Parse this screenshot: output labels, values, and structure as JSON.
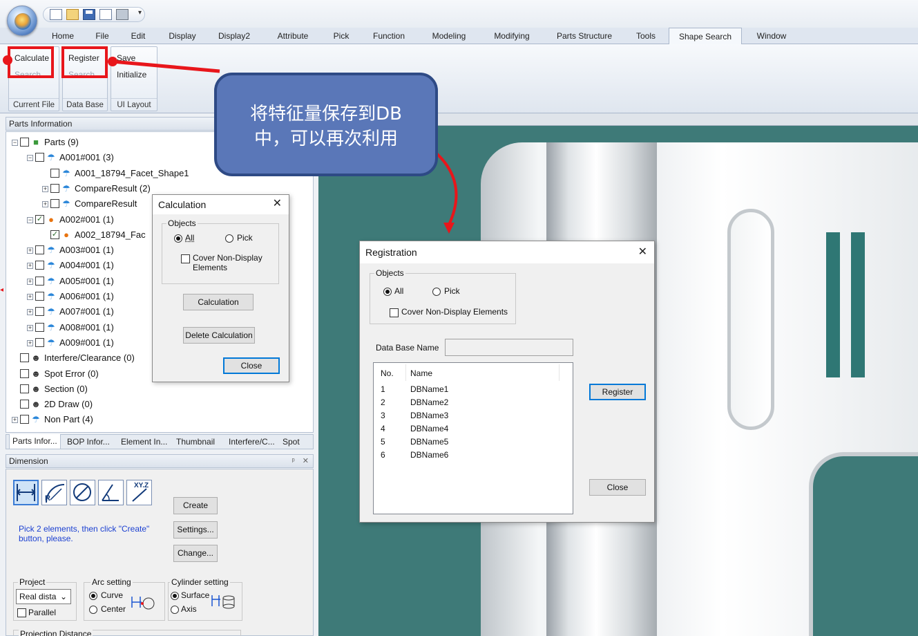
{
  "quick_access": {
    "more_label": "▾"
  },
  "ribbon": {
    "tabs": [
      "Home",
      "File",
      "Edit",
      "Display",
      "Display2",
      "Attribute",
      "Pick",
      "Function",
      "Modeling",
      "Modifying",
      "Parts Structure",
      "Tools",
      "Shape Search",
      "Window"
    ],
    "active_tab": "Shape Search",
    "groups": {
      "current_file": {
        "label": "Current File",
        "buttons": [
          "Calculate",
          "Search"
        ]
      },
      "data_base": {
        "label": "Data Base",
        "buttons": [
          "Register",
          "Search"
        ]
      },
      "ui_layout": {
        "label": "UI Layout",
        "buttons": [
          "Save",
          "Initialize"
        ]
      }
    }
  },
  "parts_panel": {
    "title": "Parts Information",
    "nodes": [
      {
        "label": "Parts (9)",
        "checked": false
      },
      {
        "label": "A001#001 (3)",
        "checked": false
      },
      {
        "label": "A001_18794_Facet_Shape1",
        "checked": false
      },
      {
        "label": "CompareResult (2)",
        "checked": false
      },
      {
        "label": "CompareResult",
        "checked": false
      },
      {
        "label": "A002#001 (1)",
        "checked": true
      },
      {
        "label": "A002_18794_Fac",
        "checked": true
      },
      {
        "label": "A003#001 (1)",
        "checked": false
      },
      {
        "label": "A004#001 (1)",
        "checked": false
      },
      {
        "label": "A005#001 (1)",
        "checked": false
      },
      {
        "label": "A006#001 (1)",
        "checked": false
      },
      {
        "label": "A007#001 (1)",
        "checked": false
      },
      {
        "label": "A008#001 (1)",
        "checked": false
      },
      {
        "label": "A009#001 (1)",
        "checked": false
      },
      {
        "label": "Interfere/Clearance (0)",
        "checked": false
      },
      {
        "label": "Spot Error (0)",
        "checked": false
      },
      {
        "label": "Section (0)",
        "checked": false
      },
      {
        "label": "2D Draw (0)",
        "checked": false
      },
      {
        "label": "Non Part (4)",
        "checked": false
      }
    ],
    "tabs": [
      "Parts Infor...",
      "BOP Infor...",
      "Element In...",
      "Thumbnail",
      "Interfere/C...",
      "Spot"
    ]
  },
  "dimension_panel": {
    "title": "Dimension",
    "pin": "ᵖ",
    "close": "✕",
    "tool_labels": {
      "radius": "R",
      "xyz": "XY.Z"
    },
    "hint": "Pick 2 elements, then click \"Create\" button, please.",
    "buttons": {
      "create": "Create",
      "settings": "Settings...",
      "change": "Change..."
    },
    "project": {
      "label": "Project",
      "value": "Real dista",
      "parallel": "Parallel"
    },
    "arc": {
      "label": "Arc setting",
      "curve": "Curve",
      "center": "Center",
      "selected": "Curve"
    },
    "cylinder": {
      "label": "Cylinder setting",
      "surface": "Surface",
      "axis": "Axis",
      "selected": "Surface"
    },
    "projection_distance": "Projection Distance"
  },
  "calculation_dialog": {
    "title": "Calculation",
    "objects_label": "Objects",
    "all": "All",
    "pick": "Pick",
    "selected": "All",
    "cover_label": "Cover Non-Display Elements",
    "cover_line1": "Cover Non-Display",
    "cover_line2": "Elements",
    "calc_button": "Calculation",
    "delete_button": "Delete Calculation",
    "close_button": "Close"
  },
  "registration_dialog": {
    "title": "Registration",
    "objects_label": "Objects",
    "all": "All",
    "pick": "Pick",
    "selected": "All",
    "cover_label": "Cover Non-Display Elements",
    "db_name_label": "Data Base Name",
    "db_name_value": "",
    "columns": [
      "No.",
      "Name"
    ],
    "rows": [
      {
        "no": "1",
        "name": "DBName1"
      },
      {
        "no": "2",
        "name": "DBName2"
      },
      {
        "no": "3",
        "name": "DBName3"
      },
      {
        "no": "4",
        "name": "DBName4"
      },
      {
        "no": "5",
        "name": "DBName5"
      },
      {
        "no": "6",
        "name": "DBName6"
      }
    ],
    "register_button": "Register",
    "close_button": "Close"
  },
  "annotation": {
    "line1": "将特征量保存到DB",
    "line2": "中，可以再次利用",
    "color": "#e8161b",
    "callout_color": "#5a77b8"
  }
}
